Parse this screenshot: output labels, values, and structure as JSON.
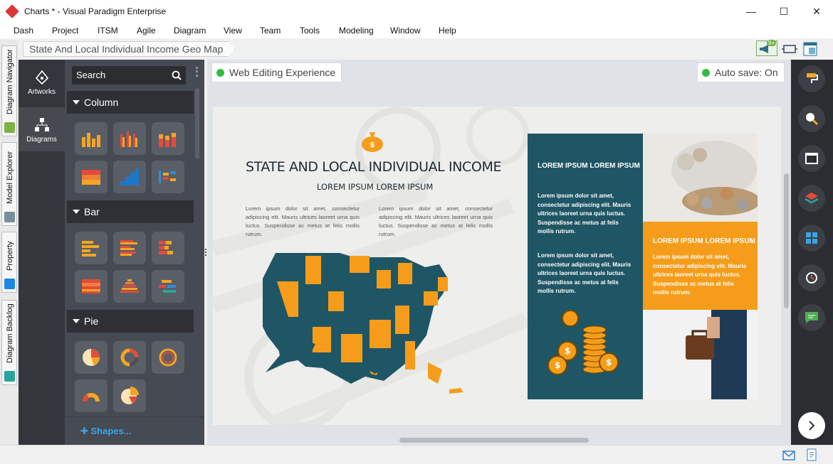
{
  "window": {
    "title": "Charts * - Visual Paradigm Enterprise",
    "minimize": "—",
    "maximize": "☐",
    "close": "✕"
  },
  "menu": [
    "Dash",
    "Project",
    "ITSM",
    "Agile",
    "Diagram",
    "View",
    "Team",
    "Tools",
    "Modeling",
    "Window",
    "Help"
  ],
  "left_tabs": [
    "Diagram Navigator",
    "Model Explorer",
    "Property",
    "Diagram Backlog"
  ],
  "breadcrumb": "State And Local Individual Income Geo Map",
  "notification_badge": "9+",
  "rail": {
    "artworks": "Artworks",
    "diagrams": "Diagrams"
  },
  "palette": {
    "search_placeholder": "Search",
    "sections": [
      "Column",
      "Bar",
      "Pie"
    ],
    "shapes_link": "Shapes..."
  },
  "canvas": {
    "web_editing": "Web Editing Experience",
    "auto_save": "Auto save: On"
  },
  "slide": {
    "title": "STATE AND LOCAL INDIVIDUAL INCOME",
    "subtitle": "LOREM IPSUM LOREM IPSUM",
    "para": "Lorem ipsum dolor sit amet, consectetur adipiscing elit. Mauris ultrices laoreet urna quis luctus. Suspendisse ac metus at felis mollis rutrum.",
    "teal_heading": "LOREM IPSUM LOREM IPSUM",
    "teal_para": "Lorem ipsum dolor sit amet, consectetur adipiscing elit. Mauris ultrices laoreet urna quis luctus. Suspendisse ac metus at felis mollis rutrum.",
    "orange_heading": "LOREM IPSUM LOREM IPSUM",
    "orange_para": "Lorem ipsum dolor sit amet, consectetur adipiscing elit. Mauris ultrices laoreet urna quis luctus. Suspendisse ac metus at felis mollis rutrum.",
    "coin_symbol": "$"
  },
  "colors": {
    "teal": "#1f5665",
    "orange": "#f59d1a",
    "accent_blue": "#3aa5e6",
    "status_green": "#2fbf3f"
  }
}
